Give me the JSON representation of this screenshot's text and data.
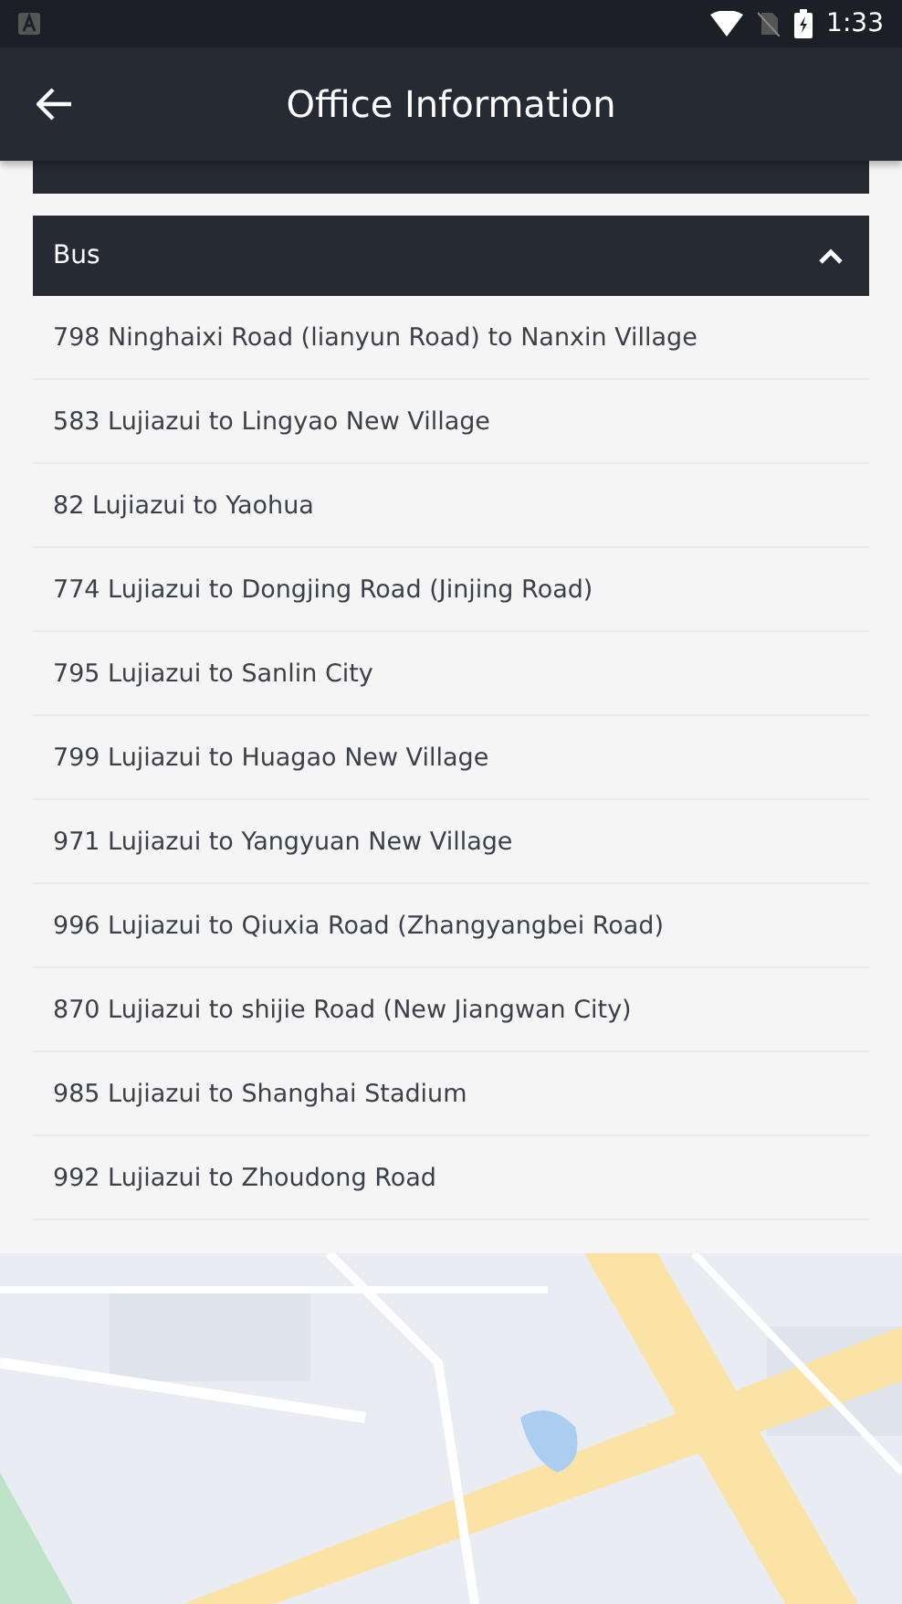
{
  "status_bar": {
    "time": "1:33"
  },
  "app_bar": {
    "title": "Office Information"
  },
  "section": {
    "title": "Bus",
    "expanded": true,
    "routes": [
      "798 Ninghaixi Road (lianyun Road) to Nanxin Village",
      "583 Lujiazui to Lingyao New Village",
      "82 Lujiazui to Yaohua",
      "774 Lujiazui to Dongjing Road (Jinjing Road)",
      "795 Lujiazui to Sanlin City",
      "799 Lujiazui to Huagao New Village",
      "971 Lujiazui to Yangyuan New Village",
      "996 Lujiazui to Qiuxia Road (Zhangyangbei Road)",
      "870 Lujiazui to shijie Road (New Jiangwan City)",
      "985 Lujiazui to Shanghai Stadium",
      "992 Lujiazui to Zhoudong Road"
    ]
  }
}
